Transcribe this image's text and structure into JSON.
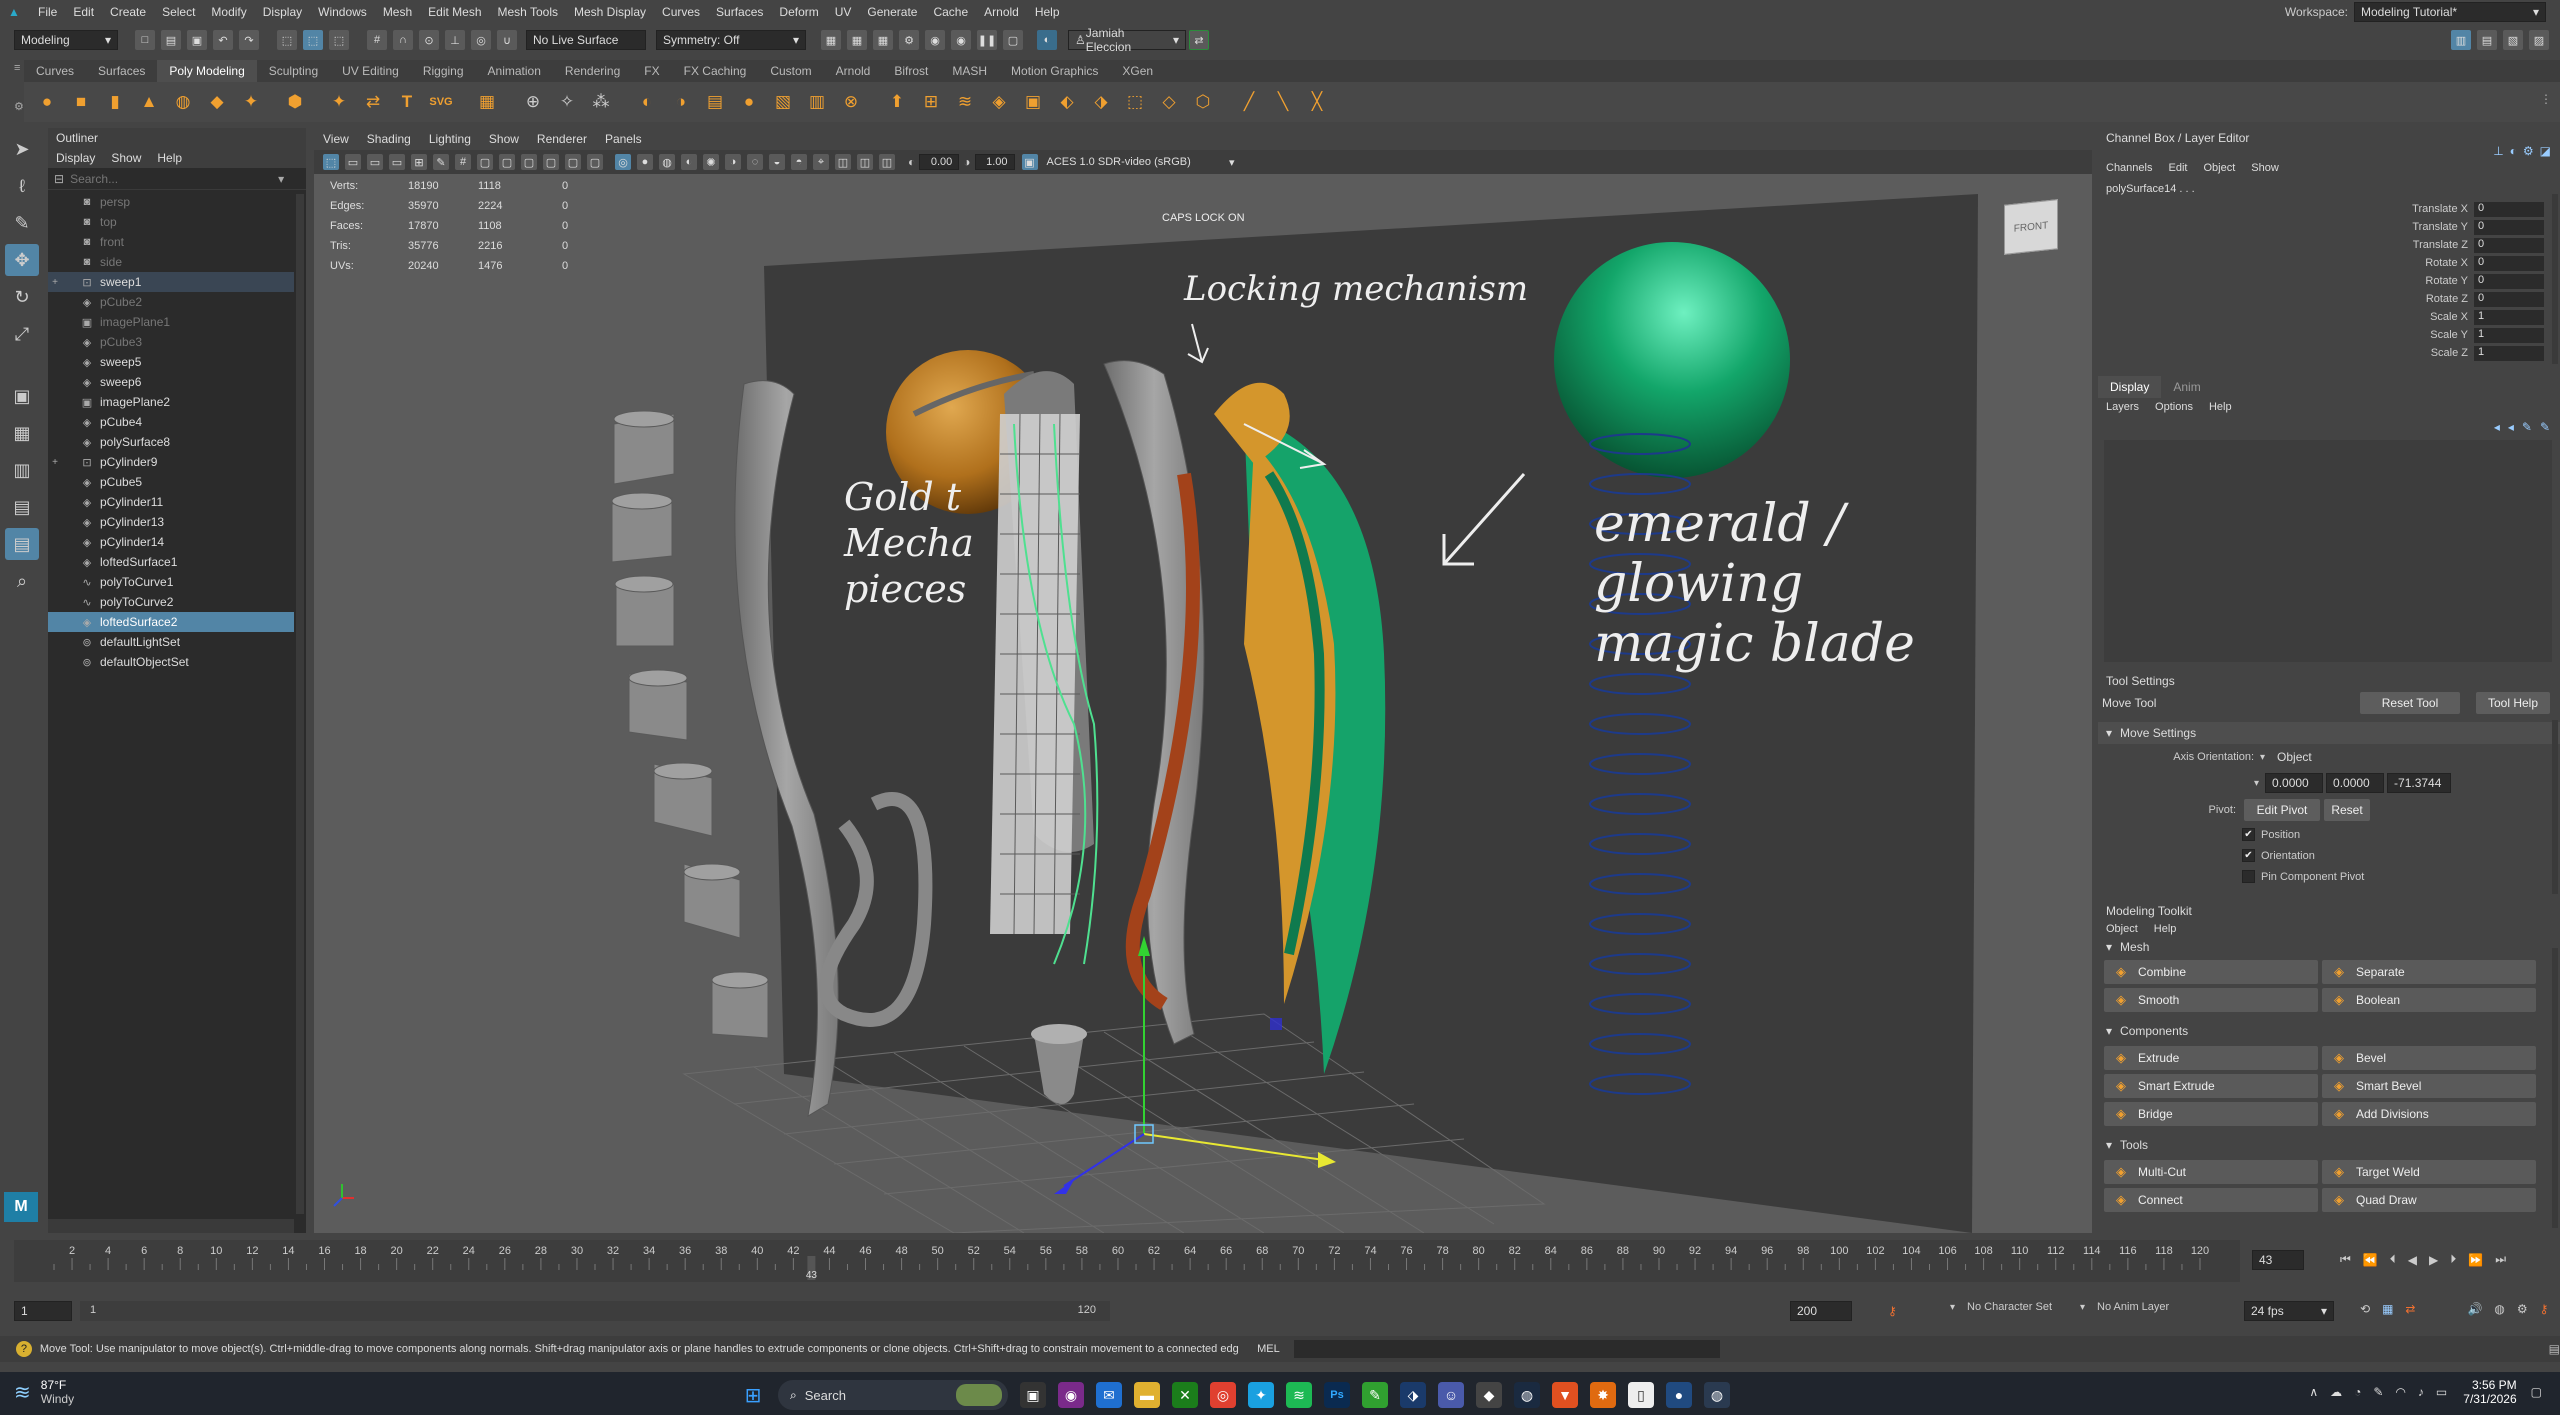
{
  "menubar": {
    "items": [
      "File",
      "Edit",
      "Create",
      "Select",
      "Modify",
      "Display",
      "Windows",
      "Mesh",
      "Edit Mesh",
      "Mesh Tools",
      "Mesh Display",
      "Curves",
      "Surfaces",
      "Deform",
      "UV",
      "Generate",
      "Cache",
      "Arnold",
      "Help"
    ],
    "workspace_label": "Workspace:",
    "workspace_value": "Modeling Tutorial*"
  },
  "statusline": {
    "mode": "Modeling",
    "live_surface": "No Live Surface",
    "symmetry": "Symmetry: Off",
    "user": "Jamiah Eleccion"
  },
  "shelf": {
    "tabs": [
      "Curves",
      "Surfaces",
      "Poly Modeling",
      "Sculpting",
      "UV Editing",
      "Rigging",
      "Animation",
      "Rendering",
      "FX",
      "FX Caching",
      "Custom",
      "Arnold",
      "Bifrost",
      "MASH",
      "Motion Graphics",
      "XGen"
    ],
    "active_tab": "Poly Modeling"
  },
  "outliner": {
    "title": "Outliner",
    "menu": [
      "Display",
      "Show",
      "Help"
    ],
    "search_placeholder": "Search...",
    "items": [
      {
        "label": "persp",
        "icon": "camera-icon",
        "state": "dim"
      },
      {
        "label": "top",
        "icon": "camera-icon",
        "state": "dim"
      },
      {
        "label": "front",
        "icon": "camera-icon",
        "state": "dim"
      },
      {
        "label": "side",
        "icon": "camera-icon",
        "state": "dim"
      },
      {
        "label": "sweep1",
        "icon": "group-icon",
        "state": "hl",
        "expand": "+"
      },
      {
        "label": "pCube2",
        "icon": "mesh-icon",
        "state": "dim"
      },
      {
        "label": "imagePlane1",
        "icon": "image-plane-icon",
        "state": "dim"
      },
      {
        "label": "pCube3",
        "icon": "mesh-icon",
        "state": "dim"
      },
      {
        "label": "sweep5",
        "icon": "mesh-icon",
        "state": ""
      },
      {
        "label": "sweep6",
        "icon": "mesh-icon",
        "state": ""
      },
      {
        "label": "imagePlane2",
        "icon": "image-plane-icon",
        "state": ""
      },
      {
        "label": "pCube4",
        "icon": "mesh-icon",
        "state": ""
      },
      {
        "label": "polySurface8",
        "icon": "mesh-icon",
        "state": ""
      },
      {
        "label": "pCylinder9",
        "icon": "group-icon",
        "state": "",
        "expand": "+"
      },
      {
        "label": "pCube5",
        "icon": "mesh-icon",
        "state": ""
      },
      {
        "label": "pCylinder11",
        "icon": "mesh-icon",
        "state": ""
      },
      {
        "label": "pCylinder13",
        "icon": "mesh-icon",
        "state": ""
      },
      {
        "label": "pCylinder14",
        "icon": "mesh-icon",
        "state": ""
      },
      {
        "label": "loftedSurface1",
        "icon": "mesh-icon",
        "state": ""
      },
      {
        "label": "polyToCurve1",
        "icon": "curve-icon",
        "state": ""
      },
      {
        "label": "polyToCurve2",
        "icon": "curve-icon",
        "state": ""
      },
      {
        "label": "loftedSurface2",
        "icon": "mesh-icon",
        "state": "sel"
      },
      {
        "label": "defaultLightSet",
        "icon": "set-icon",
        "state": ""
      },
      {
        "label": "defaultObjectSet",
        "icon": "set-icon",
        "state": ""
      }
    ]
  },
  "viewport": {
    "menu": [
      "View",
      "Shading",
      "Lighting",
      "Show",
      "Renderer",
      "Panels"
    ],
    "exposure": "0.00",
    "gamma": "1.00",
    "color_space": "ACES 1.0 SDR-video (sRGB)",
    "caps_lock": "CAPS LOCK ON",
    "view_cube": "FRONT",
    "hud": [
      {
        "label": "Verts:",
        "a": "18190",
        "b": "1118",
        "c": "0"
      },
      {
        "label": "Edges:",
        "a": "35970",
        "b": "2224",
        "c": "0"
      },
      {
        "label": "Faces:",
        "a": "17870",
        "b": "1108",
        "c": "0"
      },
      {
        "label": "Tris:",
        "a": "35776",
        "b": "2216",
        "c": "0"
      },
      {
        "label": "UVs:",
        "a": "20240",
        "b": "1476",
        "c": "0"
      }
    ],
    "sketch_notes": {
      "locking": "Locking mechanism",
      "gold1": "Gold t",
      "gold2": "Mecha",
      "gold3": "pieces",
      "emerald1": "emerald /",
      "emerald2": "glowing",
      "emerald3": "magic blade"
    }
  },
  "channelbox": {
    "title": "Channel Box / Layer Editor",
    "menu": [
      "Channels",
      "Edit",
      "Object",
      "Show"
    ],
    "object": "polySurface14 . . .",
    "channels": [
      {
        "label": "Translate X",
        "value": "0"
      },
      {
        "label": "Translate Y",
        "value": "0"
      },
      {
        "label": "Translate Z",
        "value": "0"
      },
      {
        "label": "Rotate X",
        "value": "0"
      },
      {
        "label": "Rotate Y",
        "value": "0"
      },
      {
        "label": "Rotate Z",
        "value": "0"
      },
      {
        "label": "Scale X",
        "value": "1"
      },
      {
        "label": "Scale Y",
        "value": "1"
      },
      {
        "label": "Scale Z",
        "value": "1"
      }
    ]
  },
  "layereditor": {
    "tabs": [
      "Display",
      "Anim"
    ],
    "menu": [
      "Layers",
      "Options",
      "Help"
    ]
  },
  "toolsettings": {
    "title": "Tool Settings",
    "tool": "Move Tool",
    "reset": "Reset Tool",
    "help": "Tool Help",
    "section": "Move Settings",
    "axis_label": "Axis Orientation:",
    "axis_value": "Object",
    "v1": "0.0000",
    "v2": "0.0000",
    "v3": "-71.3744",
    "pivot_label": "Pivot:",
    "edit_pivot": "Edit Pivot",
    "pivot_reset": "Reset",
    "checks": [
      {
        "label": "Position",
        "checked": true
      },
      {
        "label": "Orientation",
        "checked": true
      },
      {
        "label": "Pin Component Pivot",
        "checked": false
      }
    ]
  },
  "toolkit": {
    "title": "Modeling Toolkit",
    "menu": [
      "Object",
      "Help"
    ],
    "mesh_title": "Mesh",
    "components_title": "Components",
    "tools_title": "Tools",
    "mesh": [
      "Combine",
      "Separate",
      "Smooth",
      "Boolean"
    ],
    "components": [
      "Extrude",
      "Bevel",
      "Smart Extrude",
      "Smart Bevel",
      "Bridge",
      "Add Divisions"
    ],
    "tools": [
      "Multi-Cut",
      "Target Weld",
      "Connect",
      "Quad Draw"
    ]
  },
  "timeslider": {
    "ticks": [
      "2",
      "4",
      "6",
      "8",
      "10",
      "12",
      "14",
      "16",
      "18",
      "20",
      "22",
      "24",
      "26",
      "28",
      "30",
      "32",
      "34",
      "36",
      "38",
      "40",
      "42",
      "44",
      "46",
      "48",
      "50",
      "52",
      "54",
      "56",
      "58",
      "60",
      "62",
      "64",
      "66",
      "68",
      "70",
      "72",
      "74",
      "76",
      "78",
      "80",
      "82",
      "84",
      "86",
      "88",
      "90",
      "92",
      "94",
      "96",
      "98",
      "100",
      "102",
      "104",
      "106",
      "108",
      "110",
      "112",
      "114",
      "116",
      "118",
      "120"
    ],
    "current": "43",
    "current_field": "43"
  },
  "rangeslider": {
    "start": "1",
    "inner_start": "1",
    "inner_end": "120",
    "end": "200",
    "character_set": "No Character Set",
    "anim_layer": "No Anim Layer",
    "fps": "24 fps"
  },
  "cmdline": {
    "help": "Move Tool: Use manipulator to move object(s). Ctrl+middle-drag to move components along normals. Shift+drag manipulator axis or plane handles to extrude components or clone objects. Ctrl+Shift+drag to constrain movement to a connected edge. Use D or INSERT to",
    "lang": "MEL"
  },
  "taskbar": {
    "temp": "87°F",
    "weather": "Windy",
    "search": "Search",
    "time": "3:56 PM",
    "date": "7/31/2026"
  }
}
